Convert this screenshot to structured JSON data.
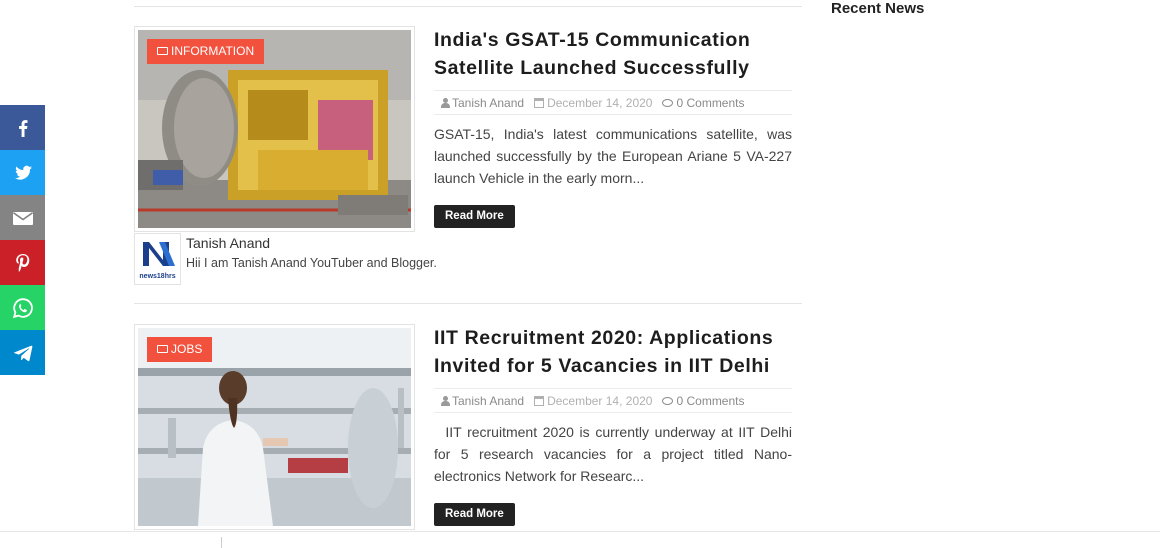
{
  "sidebar": {
    "recent_title": "Recent News"
  },
  "posts": [
    {
      "category": "INFORMATION",
      "title": "India's GSAT-15 Communication Satellite Launched Successfully",
      "author": "Tanish Anand",
      "date": "December 14, 2020",
      "comments": "0 Comments",
      "excerpt": "GSAT-15, India's latest communications satellite, was launched successfully by the European Ariane 5 VA-227 launch Vehicle in the early morn...",
      "read_more": "Read More"
    },
    {
      "category": "JOBS",
      "title": "IIT Recruitment 2020: Applications Invited for 5 Vacancies in IIT Delhi",
      "author": "Tanish Anand",
      "date": "December 14, 2020",
      "comments": "0 Comments",
      "excerpt": "  IIT recruitment 2020 is currently underway at IIT Delhi for 5 research vacancies for a project titled Nano-electronics Network for Researc...",
      "read_more": "Read More"
    }
  ],
  "author_box": {
    "name": "Tanish Anand",
    "bio": "Hii I am Tanish Anand YouTuber and Blogger.",
    "logo_text": "news18hrs"
  },
  "share": [
    {
      "icon": "facebook-icon",
      "color": "#3b5998"
    },
    {
      "icon": "twitter-icon",
      "color": "#1da1f2"
    },
    {
      "icon": "email-icon",
      "color": "#848484"
    },
    {
      "icon": "pinterest-icon",
      "color": "#cb2027"
    },
    {
      "icon": "whatsapp-icon",
      "color": "#25d366"
    },
    {
      "icon": "telegram-icon",
      "color": "#0088cc"
    }
  ],
  "colors": {
    "badge": "#f2513d",
    "button": "#222222"
  }
}
